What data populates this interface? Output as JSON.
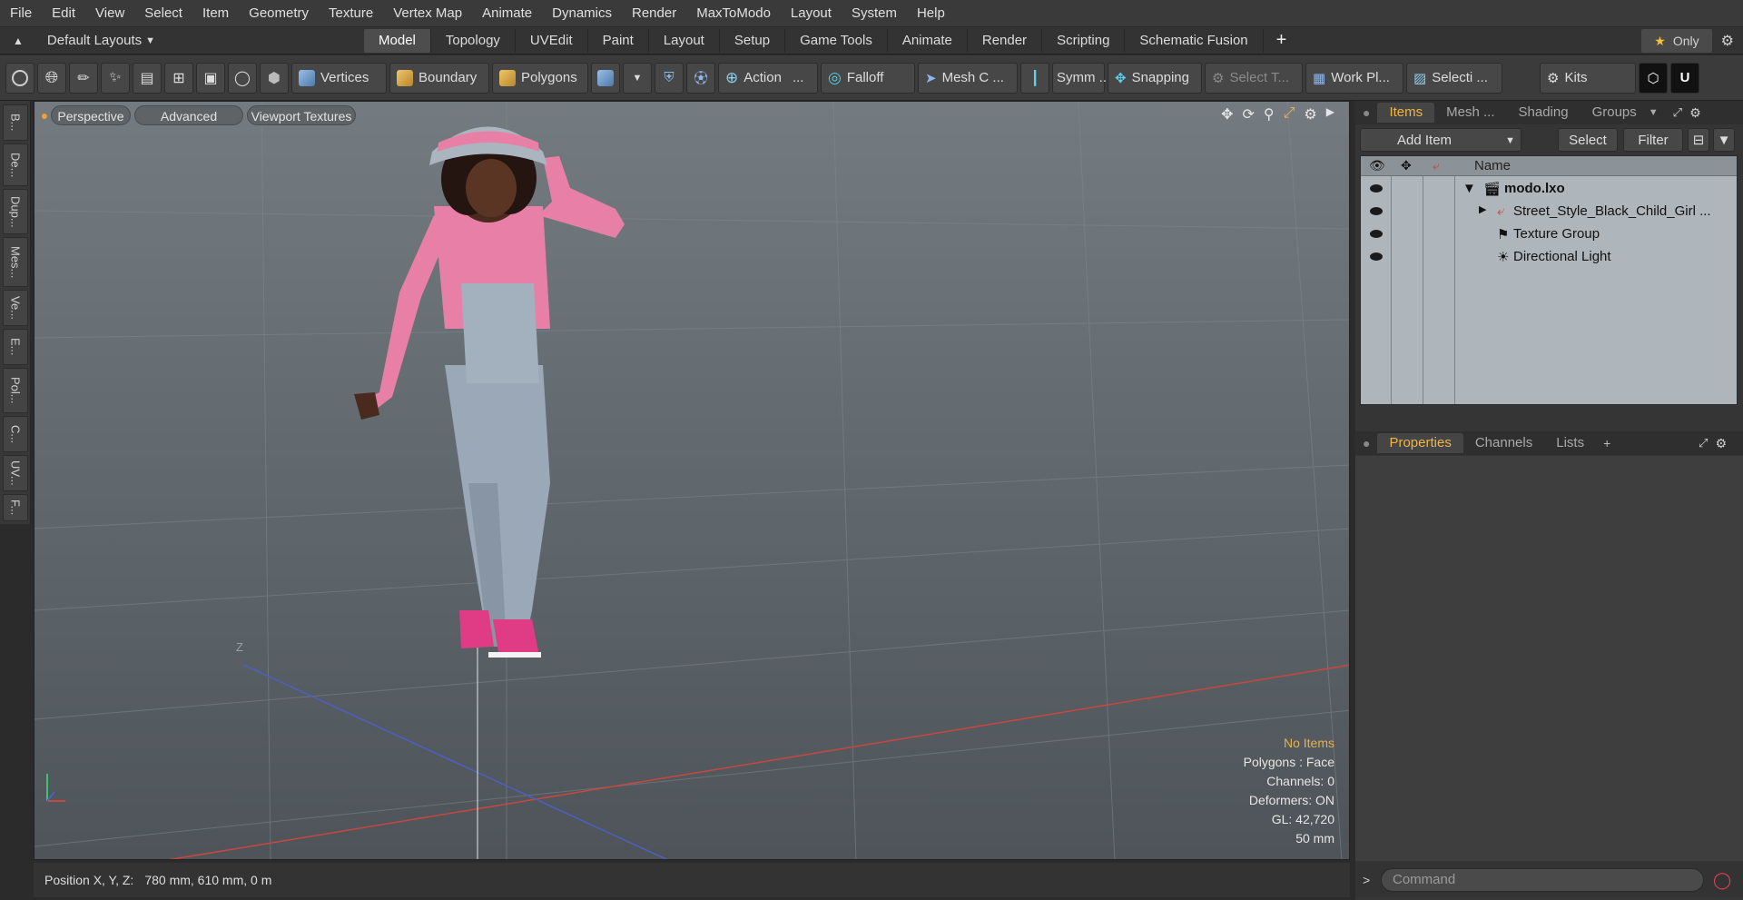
{
  "menu": [
    "File",
    "Edit",
    "View",
    "Select",
    "Item",
    "Geometry",
    "Texture",
    "Vertex Map",
    "Animate",
    "Dynamics",
    "Render",
    "MaxToModo",
    "Layout",
    "System",
    "Help"
  ],
  "layout_selector": "Default Layouts",
  "layout_tabs": [
    "Model",
    "Topology",
    "UVEdit",
    "Paint",
    "Layout",
    "Setup",
    "Game Tools",
    "Animate",
    "Render",
    "Scripting",
    "Schematic Fusion"
  ],
  "active_layout_tab": "Model",
  "only_label": "Only",
  "toolbar": {
    "vertices": "Vertices",
    "boundary": "Boundary",
    "polygons": "Polygons",
    "action": "Action",
    "action_more": "...",
    "falloff": "Falloff",
    "mesh": "Mesh C ...",
    "symm": "Symm ...",
    "snapping": "Snapping",
    "select_t": "Select T...",
    "workplane": "Work Pl...",
    "selecti": "Selecti ...",
    "kits": "Kits"
  },
  "left_tabs": [
    "B...",
    "De...",
    "Dup...",
    "Mes...",
    "Ve...",
    "E...",
    "Pol...",
    "C...",
    "UV...",
    "F..."
  ],
  "viewport": {
    "view_mode": "Perspective",
    "advanced": "Advanced",
    "textures": "Viewport Textures",
    "axis_z_label": "Z",
    "hud": {
      "selection": "No Items",
      "polygons": "Polygons : Face",
      "channels": "Channels: 0",
      "deformers": "Deformers: ON",
      "gl": "GL: 42,720",
      "scale": "50 mm"
    }
  },
  "status": {
    "label": "Position X, Y, Z:",
    "value": "780 mm, 610 mm, 0 m"
  },
  "items_panel": {
    "tabs": [
      "Items",
      "Mesh ...",
      "Shading",
      "Groups"
    ],
    "active_tab": "Items",
    "add_item": "Add Item",
    "select": "Select",
    "filter": "Filter",
    "name_header": "Name",
    "rows": [
      {
        "name": "modo.lxo"
      },
      {
        "name": "Street_Style_Black_Child_Girl ..."
      },
      {
        "name": "Texture Group"
      },
      {
        "name": "Directional Light"
      }
    ]
  },
  "properties_panel": {
    "tabs": [
      "Properties",
      "Channels",
      "Lists"
    ],
    "add": "+"
  },
  "command": {
    "placeholder": "Command"
  },
  "colors": {
    "accent": "#f0b545",
    "x_axis": "#d4423b",
    "z_axis": "#3f58c4",
    "y_axis": "#3cc36b",
    "shirt": "#e87fa7",
    "overalls": "#9aa8b7"
  }
}
